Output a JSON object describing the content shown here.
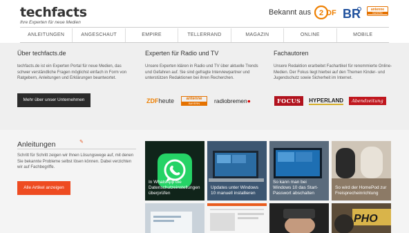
{
  "header": {
    "logo_title": "techfacts",
    "logo_subtitle": "Ihre Experten für neue Medien",
    "known_from": "Bekannt aus",
    "logos": [
      "ZDF",
      "BR",
      "antenne BAYERN"
    ]
  },
  "nav": {
    "items": [
      "Anleitungen",
      "Angeschaut",
      "Empire",
      "Tellerrand",
      "Magazin",
      "Online",
      "Mobile"
    ]
  },
  "about": {
    "title": "Über techfacts.de",
    "text": "techfacts.de ist ein Experten Portal für neue Medien, das schwer verständliche Fragen möglichst einfach in Form von Ratgebern, Anleitungen und Erklärungen beantwortet.",
    "button": "Mehr über unser Unternehmen"
  },
  "experts": {
    "title": "Experten für Radio und TV",
    "text": "Unsere Experten klären in Radio und TV über aktuelle Trends und Gefahren auf. Sie sind gefragte Interviewpartner und unterstützen Redaktionen bei ihren Recherchen.",
    "logos": {
      "zdf_a": "ZDF",
      "zdf_b": "heute",
      "antenne_a": "antenne",
      "antenne_b": "BAYERN",
      "radiobremen_a": "radiobremen",
      "radiobremen_b": "●"
    }
  },
  "authors": {
    "title": "Fachautoren",
    "text": "Unsere Redaktion erarbeitet Fachartikel für renommierte Online-Medien. Der Fokus liegt hierbei auf den Themen Kinder- und Jugendschutz sowie Sicherheit im Internet.",
    "logos": {
      "focus": "FOCUS",
      "hyperland": "HYPERLAND",
      "abendzeitung": "Abendzeitung"
    }
  },
  "guides": {
    "title": "Anleitungen",
    "text": "Schritt für Schritt zeigen wir Ihnen Lösungswege auf, mit denen Sie bekannte Probleme selbst lösen können. Dabei verzichten wir auf Fachbegriffe.",
    "button": "Alle Artikel anzeigen",
    "tiles": [
      {
        "caption": "In WhatsApp die Datenschutzeinstellungen überprüfen"
      },
      {
        "caption": "Updates unter Windows 10 manuell installieren"
      },
      {
        "caption": "So kann man bei Windows 10 das Start-Passwort abschalten"
      },
      {
        "caption": "So wird der HomePod zur Freisprecheinrichtung"
      },
      {
        "caption": ""
      },
      {
        "caption": ""
      },
      {
        "caption": ""
      },
      {
        "caption": ""
      }
    ],
    "tile_text": {
      "typhoon": "PHO"
    }
  },
  "colors": {
    "accent": "#ee4b21",
    "dark_button": "#2b2b2b",
    "whatsapp_green": "#25d366"
  }
}
